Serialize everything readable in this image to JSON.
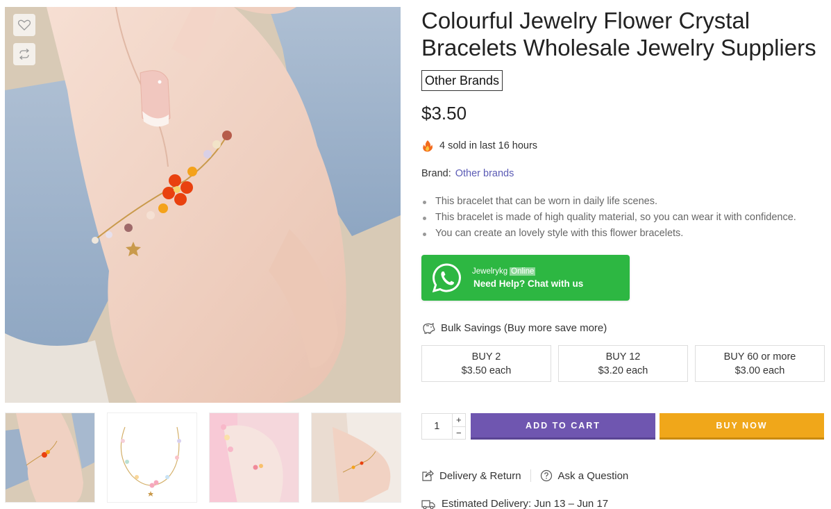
{
  "product": {
    "title": "Colourful Jewelry Flower Crystal Bracelets Wholesale Jewelry Suppliers",
    "brand_badge": "Other Brands",
    "price": "$3.50",
    "sold_text": "4 sold in last 16 hours",
    "brand_label": "Brand:",
    "brand_value": "Other brands",
    "features": [
      "This bracelet that can be worn in daily life scenes.",
      "This bracelet is made of high quality material, so you can wear it with confidence.",
      "You can create an lovely style with this flower bracelets."
    ]
  },
  "whatsapp": {
    "agent": "Jewelrykg",
    "status": "Online",
    "cta": "Need Help? Chat with us",
    "color": "#2db742"
  },
  "bulk": {
    "heading": "Bulk Savings (Buy more save more)",
    "tiers": [
      {
        "qty": "BUY 2",
        "price": "$3.50 each"
      },
      {
        "qty": "BUY 12",
        "price": "$3.20 each"
      },
      {
        "qty": "BUY 60 or more",
        "price": "$3.00 each"
      }
    ]
  },
  "purchase": {
    "quantity": "1",
    "plus": "+",
    "minus": "−",
    "add_to_cart": "ADD TO CART",
    "buy_now": "BUY NOW",
    "cart_color": "#6f56b0",
    "buy_color": "#f0a71a"
  },
  "links": {
    "delivery_return": "Delivery & Return",
    "ask_question": "Ask a Question",
    "estimated_delivery": "Estimated Delivery: Jun 13 – Jun 17"
  },
  "gallery": {
    "icons": [
      "heart-icon",
      "compare-icon"
    ]
  }
}
